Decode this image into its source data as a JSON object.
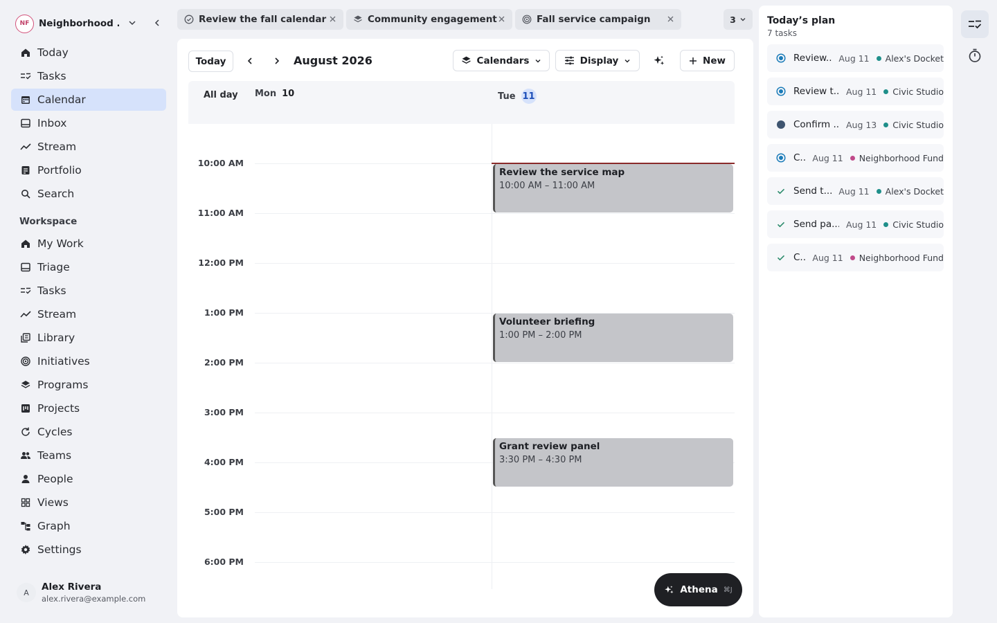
{
  "workspace": {
    "initials": "NF",
    "name": "Neighborhood ..."
  },
  "nav": {
    "primary": [
      {
        "label": "Today",
        "icon": "home-icon",
        "active": false
      },
      {
        "label": "Tasks",
        "icon": "tasks-icon",
        "active": false
      },
      {
        "label": "Calendar",
        "icon": "calendar-icon",
        "active": true
      },
      {
        "label": "Inbox",
        "icon": "inbox-icon",
        "active": false
      },
      {
        "label": "Stream",
        "icon": "stream-icon",
        "active": false
      },
      {
        "label": "Portfolio",
        "icon": "portfolio-icon",
        "active": false
      },
      {
        "label": "Search",
        "icon": "search-icon",
        "active": false
      }
    ],
    "section_label": "Workspace",
    "workspace_items": [
      {
        "label": "My Work",
        "icon": "home-icon"
      },
      {
        "label": "Triage",
        "icon": "inbox-icon"
      },
      {
        "label": "Tasks",
        "icon": "tasks-icon"
      },
      {
        "label": "Stream",
        "icon": "stream-icon"
      },
      {
        "label": "Library",
        "icon": "library-icon"
      },
      {
        "label": "Initiatives",
        "icon": "target-icon"
      },
      {
        "label": "Programs",
        "icon": "layers-icon"
      },
      {
        "label": "Projects",
        "icon": "projects-icon"
      },
      {
        "label": "Cycles",
        "icon": "cycle-icon"
      },
      {
        "label": "Teams",
        "icon": "teams-icon"
      },
      {
        "label": "People",
        "icon": "person-icon"
      },
      {
        "label": "Views",
        "icon": "grid-icon"
      },
      {
        "label": "Graph",
        "icon": "graph-icon"
      },
      {
        "label": "Settings",
        "icon": "gear-icon"
      }
    ]
  },
  "user": {
    "initial": "A",
    "name": "Alex Rivera",
    "email": "alex.rivera@example.com"
  },
  "tabs": [
    {
      "label": "Review the fall calendar",
      "icon": "check-circle-icon"
    },
    {
      "label": "Community engagement",
      "icon": "layers-icon"
    },
    {
      "label": "Fall service campaign",
      "icon": "target-icon"
    }
  ],
  "tab_overflow_count": "3",
  "toolbar": {
    "today_label": "Today",
    "month": "August 2026",
    "calendars_label": "Calendars",
    "display_label": "Display",
    "new_label": "New"
  },
  "calendar": {
    "allday_label": "All day",
    "days": [
      {
        "dow": "Mon",
        "num": "10",
        "today": false
      },
      {
        "dow": "Tue",
        "num": "11",
        "today": true
      }
    ],
    "hours": [
      "10:00 AM",
      "11:00 AM",
      "12:00 PM",
      "1:00 PM",
      "2:00 PM",
      "3:00 PM",
      "4:00 PM",
      "5:00 PM",
      "6:00 PM"
    ],
    "events": [
      {
        "title": "Review the service map",
        "time": "10:00 AM – 11:00 AM"
      },
      {
        "title": "Volunteer briefing",
        "time": "1:00 PM – 2:00 PM"
      },
      {
        "title": "Grant review panel",
        "time": "3:30 PM – 4:30 PM"
      }
    ]
  },
  "athena": {
    "label": "Athena",
    "shortcut": "⌘J"
  },
  "plan": {
    "title": "Today’s plan",
    "subtitle": "7 tasks",
    "tasks": [
      {
        "title": "Review...",
        "date": "Aug 11",
        "project": "Alex's Docket",
        "status": "in-progress",
        "color": "#1f8f8a"
      },
      {
        "title": "Review t...",
        "date": "Aug 11",
        "project": "Civic Studio",
        "status": "in-progress",
        "color": "#1f8f8a"
      },
      {
        "title": "Confirm ...",
        "date": "Aug 13",
        "project": "Civic Studio",
        "status": "todo",
        "color": "#1f8f8a"
      },
      {
        "title": "C...",
        "date": "Aug 11",
        "project": "Neighborhood Fund",
        "status": "in-progress",
        "color": "#c04a8a"
      },
      {
        "title": "Send t...",
        "date": "Aug 11",
        "project": "Alex's Docket",
        "status": "done",
        "color": "#1f8f8a"
      },
      {
        "title": "Send pa...",
        "date": "Aug 11",
        "project": "Civic Studio",
        "status": "done",
        "color": "#1f8f8a"
      },
      {
        "title": "C...",
        "date": "Aug 11",
        "project": "Neighborhood Fund",
        "status": "done",
        "color": "#c04a8a"
      }
    ]
  },
  "colors": {
    "accent": "#2563eb",
    "active_nav": "#d6e2fb",
    "now_line": "#8a2a2a",
    "event_bg": "#c4c5c9"
  }
}
